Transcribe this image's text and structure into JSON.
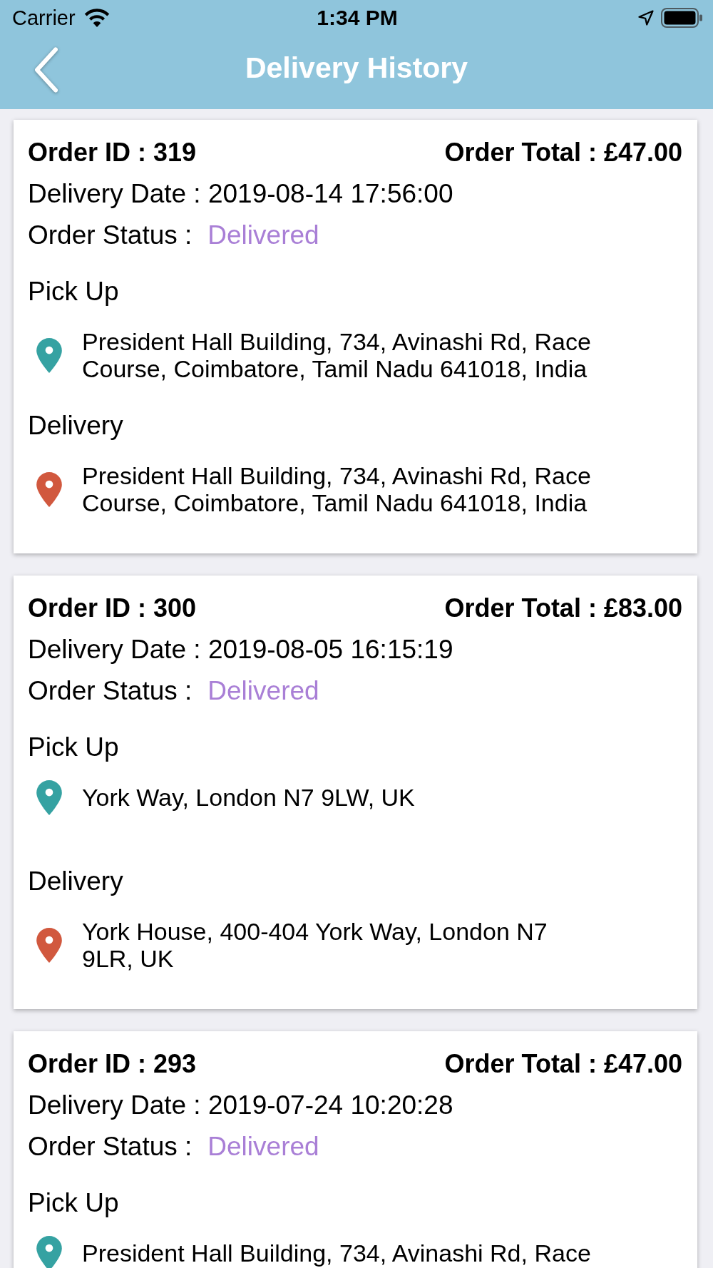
{
  "status_bar": {
    "carrier": "Carrier",
    "time": "1:34 PM"
  },
  "nav": {
    "title": "Delivery History"
  },
  "orders": [
    {
      "order_id": "Order ID : 319",
      "order_total": "Order Total : £47.00",
      "delivery_date": "Delivery Date : 2019-08-14 17:56:00",
      "status_label": "Order Status :",
      "status": "Delivered",
      "stops": [
        {
          "kind": "pickup",
          "heading": "Pick Up",
          "address": "President Hall Building, 734, Avinashi Rd, Race Course, Coimbatore, Tamil Nadu 641018, India"
        },
        {
          "kind": "delivery",
          "heading": "Delivery",
          "address": "President Hall Building, 734, Avinashi Rd, Race Course, Coimbatore, Tamil Nadu 641018, India"
        }
      ]
    },
    {
      "order_id": "Order ID : 300",
      "order_total": "Order Total : £83.00",
      "delivery_date": "Delivery Date : 2019-08-05 16:15:19",
      "status_label": "Order Status :",
      "status": "Delivered",
      "stops": [
        {
          "kind": "pickup",
          "heading": "Pick Up",
          "address": "York Way, London N7 9LW, UK"
        },
        {
          "kind": "delivery",
          "heading": "Delivery",
          "address": "York House, 400-404 York Way, London N7 9LR, UK"
        }
      ]
    },
    {
      "order_id": "Order ID : 293",
      "order_total": "Order Total : £47.00",
      "delivery_date": "Delivery Date : 2019-07-24 10:20:28",
      "status_label": "Order Status :",
      "status": "Delivered",
      "stops": [
        {
          "kind": "pickup",
          "heading": "Pick Up",
          "address": "President Hall Building, 734, Avinashi Rd, Race"
        }
      ]
    }
  ]
}
